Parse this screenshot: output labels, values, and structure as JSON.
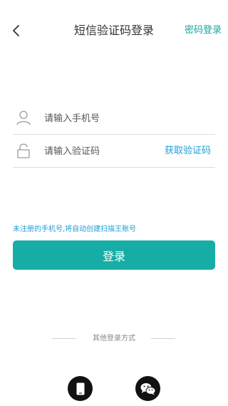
{
  "header": {
    "title": "短信验证码登录",
    "password_login": "密码登录",
    "back_icon": "chevron-left-icon"
  },
  "form": {
    "phone": {
      "placeholder": "请输入手机号",
      "icon": "user-icon"
    },
    "code": {
      "placeholder": "请输入验证码",
      "icon": "lock-icon",
      "get_code_label": "获取验证码"
    }
  },
  "notice": "未注册的手机号,将自动创建扫描王账号",
  "login_button": "登录",
  "other_login": {
    "label": "其他登录方式",
    "methods": [
      {
        "icon": "phone-icon"
      },
      {
        "icon": "wechat-icon"
      }
    ]
  },
  "colors": {
    "accent": "#16ada6",
    "link": "#1b9fd6"
  }
}
